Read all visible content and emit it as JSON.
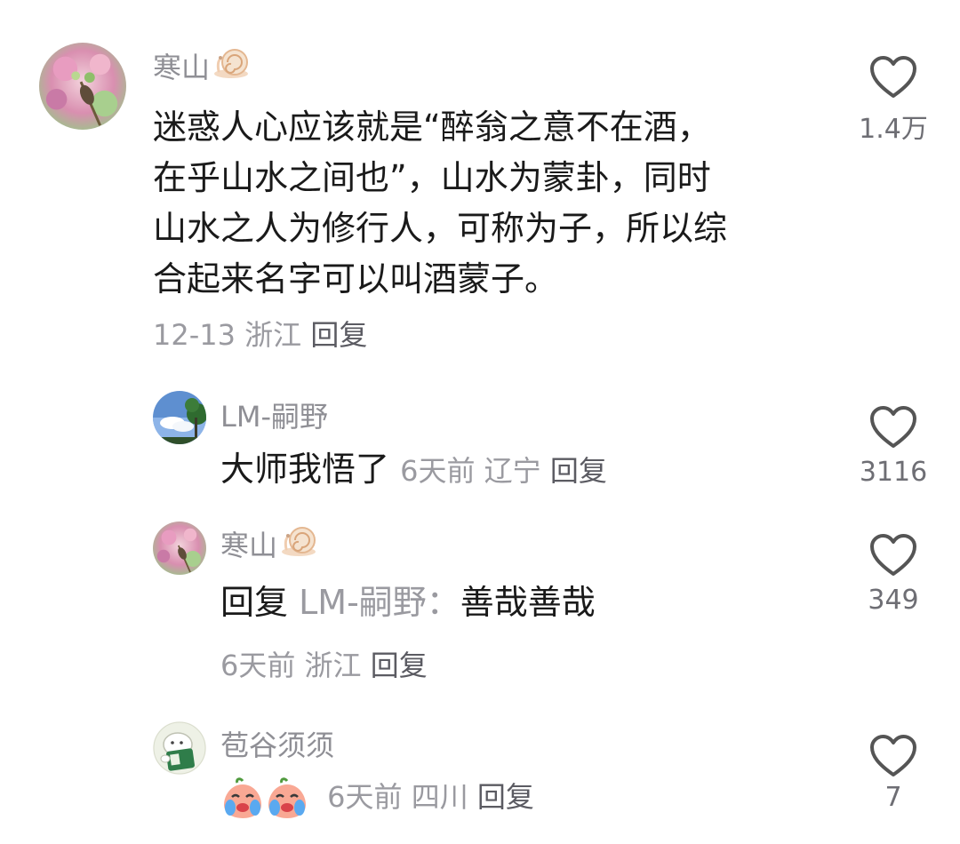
{
  "comments": [
    {
      "username": "寒山",
      "text_lines": [
        "迷惑人心应该就是“醉翁之意不在酒，",
        "在乎山水之间也”，山水为蒙卦，同时",
        "山水之人为修行人，可称为子，所以综",
        "合起来名字可以叫酒蒙子。"
      ],
      "date": "12-13",
      "location": "浙江",
      "reply_label": "回复",
      "likes": "1.4万",
      "badge_icon": "snail-icon"
    }
  ],
  "replies": [
    {
      "username": "LM-嗣野",
      "text": "大师我悟了",
      "date": "6天前",
      "location": "辽宁",
      "reply_label": "回复",
      "likes": "3116"
    },
    {
      "username": "寒山",
      "reply_prefix": "回复",
      "reply_to": "LM-嗣野：",
      "text": "善哉善哉",
      "date": "6天前",
      "location": "浙江",
      "reply_label": "回复",
      "likes": "349",
      "badge_icon": "snail-icon"
    },
    {
      "username": "苞谷须须",
      "emoji_icons": [
        "crying-peach-emoji",
        "crying-peach-emoji"
      ],
      "date": "6天前",
      "location": "四川",
      "reply_label": "回复",
      "likes": "7"
    }
  ],
  "colors": {
    "username": "#8f8f95",
    "body_text": "#1a1a1a",
    "meta_text": "#9a9aa0",
    "heart_stroke": "#555555"
  }
}
